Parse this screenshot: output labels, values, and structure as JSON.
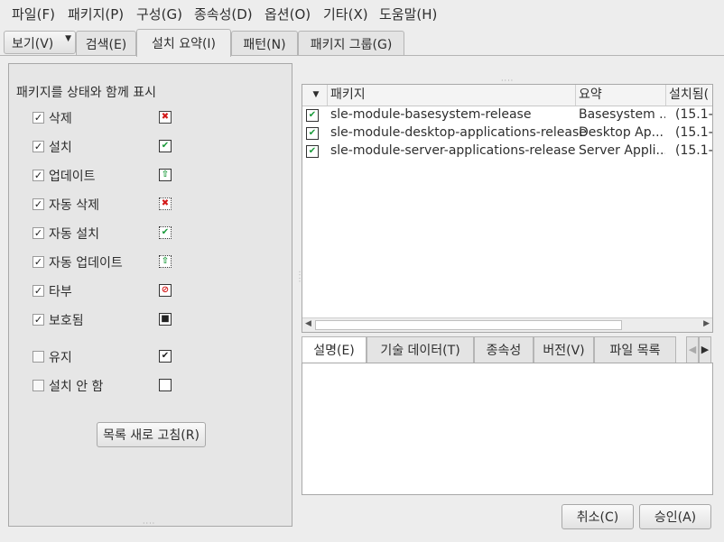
{
  "menubar": {
    "items": [
      "파일(F)",
      "패키지(P)",
      "구성(G)",
      "종속성(D)",
      "옵션(O)",
      "기타(X)",
      "도움말(H)"
    ]
  },
  "toptabs": {
    "view_label": "보기(V)",
    "tabs": [
      "검색(E)",
      "설치 요약(I)",
      "패턴(N)",
      "패키지 그룹(G)"
    ]
  },
  "left_panel": {
    "title": "패키지를 상태와 함께 표시",
    "filters": [
      {
        "label": "삭제",
        "checked": true,
        "icon": "delete-icon"
      },
      {
        "label": "설치",
        "checked": true,
        "icon": "install-icon"
      },
      {
        "label": "업데이트",
        "checked": true,
        "icon": "update-icon"
      },
      {
        "label": "자동 삭제",
        "checked": true,
        "icon": "auto-delete-icon"
      },
      {
        "label": "자동 설치",
        "checked": true,
        "icon": "auto-install-icon"
      },
      {
        "label": "자동 업데이트",
        "checked": true,
        "icon": "auto-update-icon"
      },
      {
        "label": "타부",
        "checked": true,
        "icon": "taboo-icon"
      },
      {
        "label": "보호됨",
        "checked": true,
        "icon": "protected-icon"
      },
      {
        "label": "유지",
        "checked": false,
        "icon": "keep-icon"
      },
      {
        "label": "설치 안 함",
        "checked": false,
        "icon": "do-not-install-icon"
      }
    ],
    "refresh_label": "목록 새로 고침(R)"
  },
  "package_table": {
    "columns": [
      "패키지",
      "요약",
      "설치됨("
    ],
    "rows": [
      {
        "name": "sle-module-basesystem-release",
        "summary": "Basesystem ...",
        "installed": "(15.1-"
      },
      {
        "name": "sle-module-desktop-applications-release",
        "summary": "Desktop Ap...",
        "installed": "(15.1-"
      },
      {
        "name": "sle-module-server-applications-release",
        "summary": "Server Appli...",
        "installed": "(15.1-"
      }
    ]
  },
  "detail_tabs": [
    "설명(E)",
    "기술 데이터(T)",
    "종속성",
    "버전(V)",
    "파일 목록"
  ],
  "buttons": {
    "cancel": "취소(C)",
    "accept": "승인(A)"
  },
  "colors": {
    "delete": "#d41a1a",
    "install": "#1a9a3a",
    "background": "#ededed"
  }
}
